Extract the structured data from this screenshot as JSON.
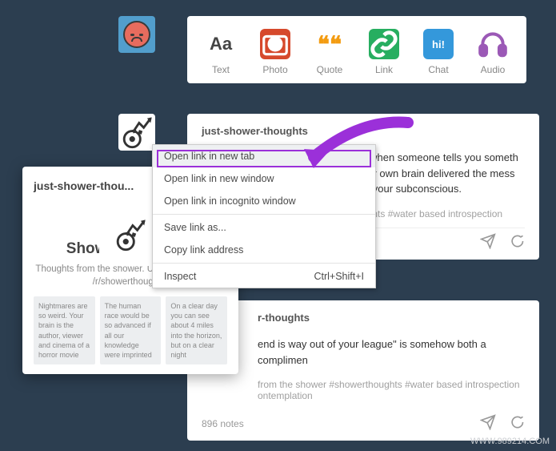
{
  "avatar": {
    "alt": "blog-avatar"
  },
  "compose": [
    {
      "key": "text",
      "label": "Text"
    },
    {
      "key": "photo",
      "label": "Photo"
    },
    {
      "key": "quote",
      "label": "Quote"
    },
    {
      "key": "link",
      "label": "Link"
    },
    {
      "key": "chat",
      "label": "Chat",
      "badge": "hi!"
    },
    {
      "key": "audio",
      "label": "Audio"
    }
  ],
  "post1": {
    "user": "just-shower-thoughts",
    "body_suffix_line1": "s when someone tells you someth",
    "body_suffix_line2": "our own brain delivered the mess",
    "body_suffix_line3": "in your subconscious.",
    "tags_suffix": "ughts  #water based introspection"
  },
  "context_menu": {
    "items": [
      {
        "label": "Open link in new tab",
        "hover": true
      },
      {
        "label": "Open link in new window",
        "hover": false
      },
      {
        "label": "Open link in incognito window",
        "hover": false
      }
    ],
    "group2": [
      {
        "label": "Save link as..."
      },
      {
        "label": "Copy link address"
      }
    ],
    "group3": [
      {
        "label": "Inspect",
        "shortcut": "Ctrl+Shift+I"
      }
    ]
  },
  "hover_card": {
    "title_truncated": "just-shower-thou...",
    "heading": "Shower Thoughts",
    "sub": "Thoughts from the shower. Usually stolen from /r/showerthoughts.",
    "thumbs": [
      "Nightmares are so weird. Your brain is the author, viewer and cinema of a horror movie",
      "The human race would be so advanced if all our knowledge were imprinted",
      "On a clear day you can see about 4 miles into the horizon, but on a clear night"
    ]
  },
  "post2": {
    "user_suffix": "r-thoughts",
    "body_suffix": "end is way out of your league\" is somehow both a complimen",
    "tags_suffix": "from the shower  #showerthoughts  #water based introspection",
    "tags_line2": "ontemplation",
    "notes": "896 notes"
  },
  "watermark": "WWW.989214.COM"
}
